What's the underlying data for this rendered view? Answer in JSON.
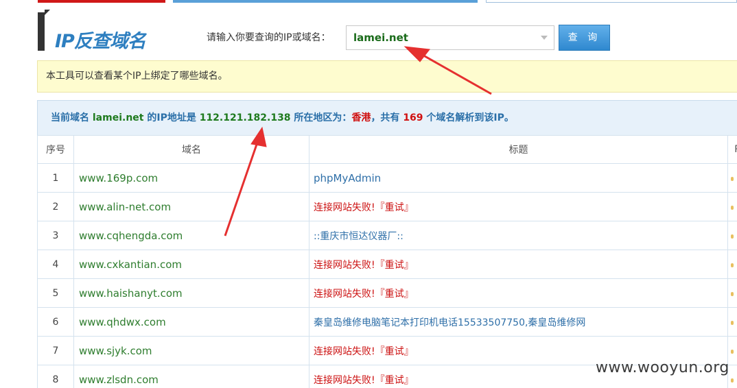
{
  "header": {
    "title": "IP反查域名",
    "search_label": "请输入你要查询的IP或域名：",
    "search_value": "lamei.net",
    "query_button": "查 询"
  },
  "notice": "本工具可以查看某个IP上绑定了哪些域名。",
  "result": {
    "prefix": "当前域名 ",
    "domain": "lamei.net",
    "mid1": " 的IP地址是 ",
    "ip": "112.121.182.138",
    "mid2": " 所在地区为：",
    "region": "香港",
    "mid3": "，共有 ",
    "count": "169",
    "suffix": " 个域名解析到该IP。"
  },
  "table": {
    "headers": [
      "序号",
      "域名",
      "标题",
      "P"
    ],
    "rows": [
      {
        "no": "1",
        "domain": "www.169p.com",
        "title": "phpMyAdmin",
        "kind": "normal"
      },
      {
        "no": "2",
        "domain": "www.alin-net.com",
        "title": "连接网站失败!",
        "retry": "『重试』",
        "kind": "fail"
      },
      {
        "no": "3",
        "domain": "www.cqhengda.com",
        "title": "::重庆市恒达仪器厂::",
        "kind": "normal"
      },
      {
        "no": "4",
        "domain": "www.cxkantian.com",
        "title": "连接网站失败!",
        "retry": "『重试』",
        "kind": "fail"
      },
      {
        "no": "5",
        "domain": "www.haishanyt.com",
        "title": "连接网站失败!",
        "retry": "『重试』",
        "kind": "fail"
      },
      {
        "no": "6",
        "domain": "www.qhdwx.com",
        "title": "秦皇岛维修电脑笔记本打印机电话15533507750,秦皇岛维修网",
        "kind": "normal"
      },
      {
        "no": "7",
        "domain": "www.sjyk.com",
        "title": "连接网站失败!",
        "retry": "『重试』",
        "kind": "fail"
      },
      {
        "no": "8",
        "domain": "www.zlsdn.com",
        "title": "连接网站失败!",
        "retry": "『重试』",
        "kind": "fail"
      }
    ]
  },
  "watermark": "www.wooyun.org",
  "colors": {
    "accent_blue": "#2e7fc0",
    "domain_green": "#2e7d2e",
    "error_red": "#cc1111",
    "arrow_red": "#e53030"
  }
}
